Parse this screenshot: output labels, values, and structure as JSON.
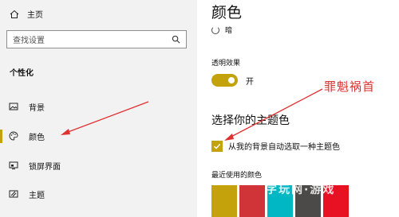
{
  "sidebar": {
    "home_label": "主页",
    "search_placeholder": "查找设置",
    "section_title": "个性化",
    "items": [
      {
        "label": "背景",
        "icon": "picture-icon"
      },
      {
        "label": "颜色",
        "icon": "palette-icon",
        "active": true
      },
      {
        "label": "锁屏界面",
        "icon": "lock-screen-icon"
      },
      {
        "label": "主题",
        "icon": "theme-icon"
      }
    ]
  },
  "main": {
    "title": "颜色",
    "dark_option": "暗",
    "transparency_label": "透明效果",
    "transparency_state": "开",
    "accent_title": "选择你的主题色",
    "auto_pick_label": "从我的背景自动选取一种主题色",
    "auto_pick_checked": true,
    "recent_colors_label": "最近使用的颜色",
    "recent_colors": [
      "#c4a20b",
      "#d13438",
      "#00b7c3",
      "#4c4a48",
      "#e81123"
    ]
  },
  "overlay": {
    "annotation_text": "罪魁祸首",
    "watermark_text": "字玩网·游戏",
    "annotation_color": "#e03030"
  },
  "colors": {
    "accent": "#c4a20b",
    "sidebar_bg": "#f2f2f2"
  }
}
